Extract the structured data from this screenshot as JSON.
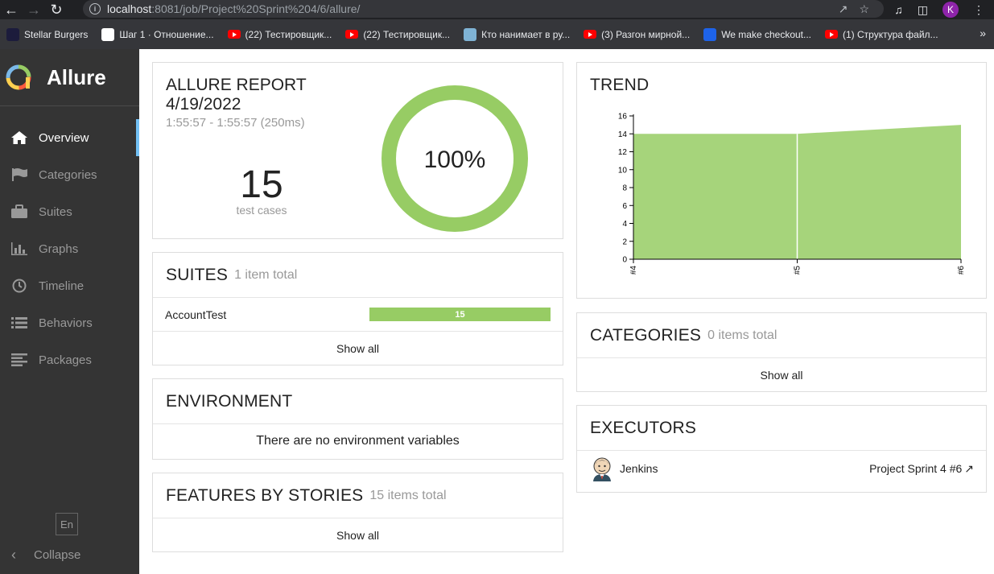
{
  "browser": {
    "url_host": "localhost",
    "url_path": ":8081/job/Project%20Sprint%204/6/allure/",
    "profile_initial": "K",
    "bookmarks": [
      {
        "label": "Stellar Burgers",
        "icon": "stellar-burgers-icon",
        "color": "#1c1c3c"
      },
      {
        "label": "Шаг 1 · Отношение...",
        "icon": "praktikum-icon",
        "color": "#ffffff"
      },
      {
        "label": "(22) Тестировщик...",
        "icon": "youtube-icon",
        "color": "#ff0000"
      },
      {
        "label": "(22) Тестировщик...",
        "icon": "youtube-icon",
        "color": "#ff0000"
      },
      {
        "label": "Кто нанимает в ру...",
        "icon": "site-icon",
        "color": "#7fb3d5"
      },
      {
        "label": "(3) Разгон мирной...",
        "icon": "youtube-icon",
        "color": "#ff0000"
      },
      {
        "label": "We make checkout...",
        "icon": "c-icon",
        "color": "#1e63e9"
      },
      {
        "label": "(1) Структура файл...",
        "icon": "youtube-icon",
        "color": "#ff0000"
      }
    ]
  },
  "sidebar": {
    "brand": "Allure",
    "items": [
      {
        "label": "Overview",
        "icon": "home-icon",
        "active": true
      },
      {
        "label": "Categories",
        "icon": "flag-icon",
        "active": false
      },
      {
        "label": "Suites",
        "icon": "briefcase-icon",
        "active": false
      },
      {
        "label": "Graphs",
        "icon": "bar-chart-icon",
        "active": false
      },
      {
        "label": "Timeline",
        "icon": "clock-icon",
        "active": false
      },
      {
        "label": "Behaviors",
        "icon": "list-icon",
        "active": false
      },
      {
        "label": "Packages",
        "icon": "align-left-icon",
        "active": false
      }
    ],
    "language": "En",
    "collapse_label": "Collapse"
  },
  "summary": {
    "title": "ALLURE REPORT",
    "date": "4/19/2022",
    "time_range": "1:55:57 - 1:55:57 (250ms)",
    "test_count": "15",
    "test_count_label": "test cases",
    "pass_rate_label": "100%",
    "pass_rate": 1.0,
    "pass_color": "#97cc64"
  },
  "suites": {
    "title": "SUITES",
    "subtitle": "1 item total",
    "rows": [
      {
        "name": "AccountTest",
        "passed": "15"
      }
    ],
    "show_all": "Show all"
  },
  "environment": {
    "title": "ENVIRONMENT",
    "message": "There are no environment variables"
  },
  "features": {
    "title": "FEATURES BY STORIES",
    "subtitle": "15 items total",
    "show_all": "Show all"
  },
  "trend": {
    "title": "TREND"
  },
  "categories": {
    "title": "CATEGORIES",
    "subtitle": "0 items total",
    "show_all": "Show all"
  },
  "executors": {
    "title": "EXECUTORS",
    "rows": [
      {
        "name": "Jenkins",
        "build": "Project Sprint 4 #6"
      }
    ]
  },
  "chart_data": {
    "type": "area",
    "title": "TREND",
    "x": [
      "#4",
      "#5",
      "#6"
    ],
    "series": [
      {
        "values": [
          14,
          14,
          15
        ],
        "color": "#97cc64"
      }
    ],
    "yticks": [
      0,
      2,
      4,
      6,
      8,
      10,
      12,
      14,
      16
    ],
    "ylim": [
      0,
      16
    ],
    "grid": false
  }
}
